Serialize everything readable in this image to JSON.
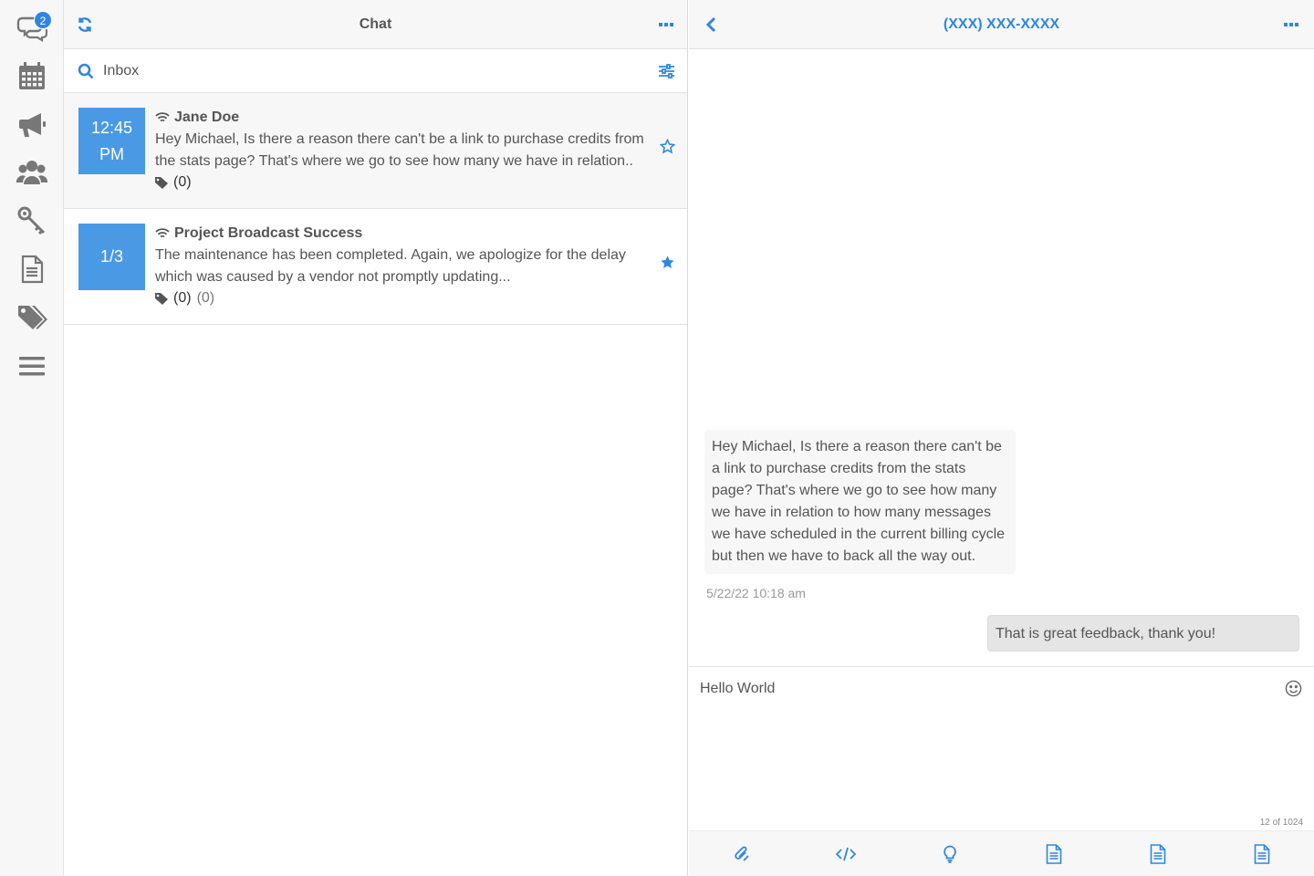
{
  "colors": {
    "accent": "#2f86e0",
    "tile": "#4a99e5",
    "icon_gray": "#777777"
  },
  "rail": {
    "items": [
      {
        "icon": "chat-bubbles-icon",
        "badge": "2"
      },
      {
        "icon": "calendar-icon"
      },
      {
        "icon": "megaphone-icon"
      },
      {
        "icon": "users-icon"
      },
      {
        "icon": "keys-icon"
      },
      {
        "icon": "document-icon"
      },
      {
        "icon": "tags-icon"
      },
      {
        "icon": "menu-icon"
      }
    ]
  },
  "chat": {
    "title": "Chat",
    "search_label": "Inbox",
    "conversations": [
      {
        "time_line1": "12:45",
        "time_line2": "PM",
        "name": "Jane Doe",
        "preview": "Hey Michael, Is there a reason there can't be a link to purchase credits from the stats page? That's where we go to see how many we have in relation..",
        "tag_count": "(0)",
        "starred": false
      },
      {
        "tile": "1/3",
        "name": "Project Broadcast Success",
        "preview": "The maintenance has been completed. Again, we apologize for the delay which was caused by a vendor not promptly updating...",
        "tag_count": "(0)",
        "extra_count": "(0)",
        "starred": true
      }
    ]
  },
  "thread": {
    "phone": "(XXX) XXX-XXXX",
    "incoming": "Hey Michael, Is there a reason there can't be a link to purchase credits from the stats page? That's where we go to see how many we have in relation to how many messages we have scheduled in the current billing cycle but then we have to back all the way out.",
    "incoming_time": "5/22/22 10:18 am",
    "outgoing": "That is great feedback, thank you!",
    "draft": "Hello World",
    "char_count": "12 of 1024",
    "toolbar_icons": [
      "paperclip-icon",
      "code-icon",
      "lightbulb-icon",
      "template-doc-icon",
      "template-doc-icon",
      "template-doc-icon"
    ]
  }
}
